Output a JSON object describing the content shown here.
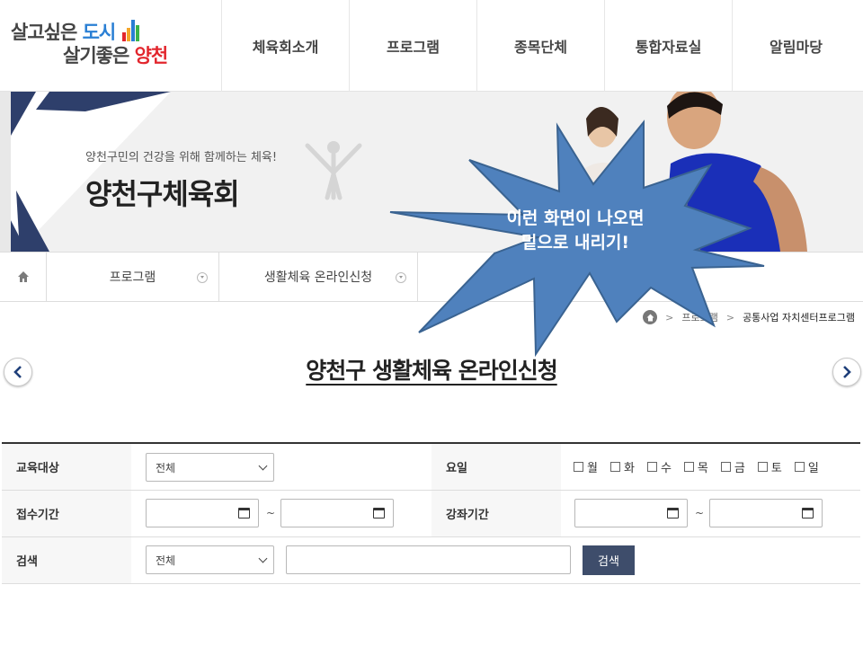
{
  "logo": {
    "line1_gray": "살고싶은 ",
    "line1_blue": "도시",
    "line2_gray": "살기좋은 ",
    "line2_red": "양천"
  },
  "nav": [
    "체육회소개",
    "프로그램",
    "종목단체",
    "통합자료실",
    "알림마당"
  ],
  "banner": {
    "subtitle": "양천구민의 건강을 위해 함께하는 체육!",
    "title": "양천구체육회"
  },
  "subnav": {
    "dropdown1": "프로그램",
    "dropdown2": "생활체육 온라인신청"
  },
  "breadcrumb": {
    "level1": "프로그램",
    "current": "공통사업 자치센터프로그램"
  },
  "page_title": "양천구 생활체육 온라인신청",
  "form": {
    "target_label": "교육대상",
    "target_value": "전체",
    "day_label": "요일",
    "days": [
      "월",
      "화",
      "수",
      "목",
      "금",
      "토",
      "일"
    ],
    "reception_label": "접수기간",
    "lecture_label": "강좌기간",
    "tilde": "~",
    "search_label": "검색",
    "search_select_value": "전체",
    "search_input_value": "",
    "search_button": "검색"
  },
  "callout": {
    "line1": "이런 화면이 나오면",
    "line2": "밑으로 내리기!"
  },
  "colors": {
    "starburst": "#4f81bd",
    "starburst_border": "#3a6391",
    "search_button": "#3e4d6b",
    "banner_navy": "#2e3f6b",
    "logo_blue": "#2a7fd4",
    "logo_red": "#e2262d"
  },
  "icons": [
    "home-icon",
    "chevron-down-icon",
    "calendar-icon",
    "chevron-left-icon",
    "chevron-right-icon"
  ]
}
